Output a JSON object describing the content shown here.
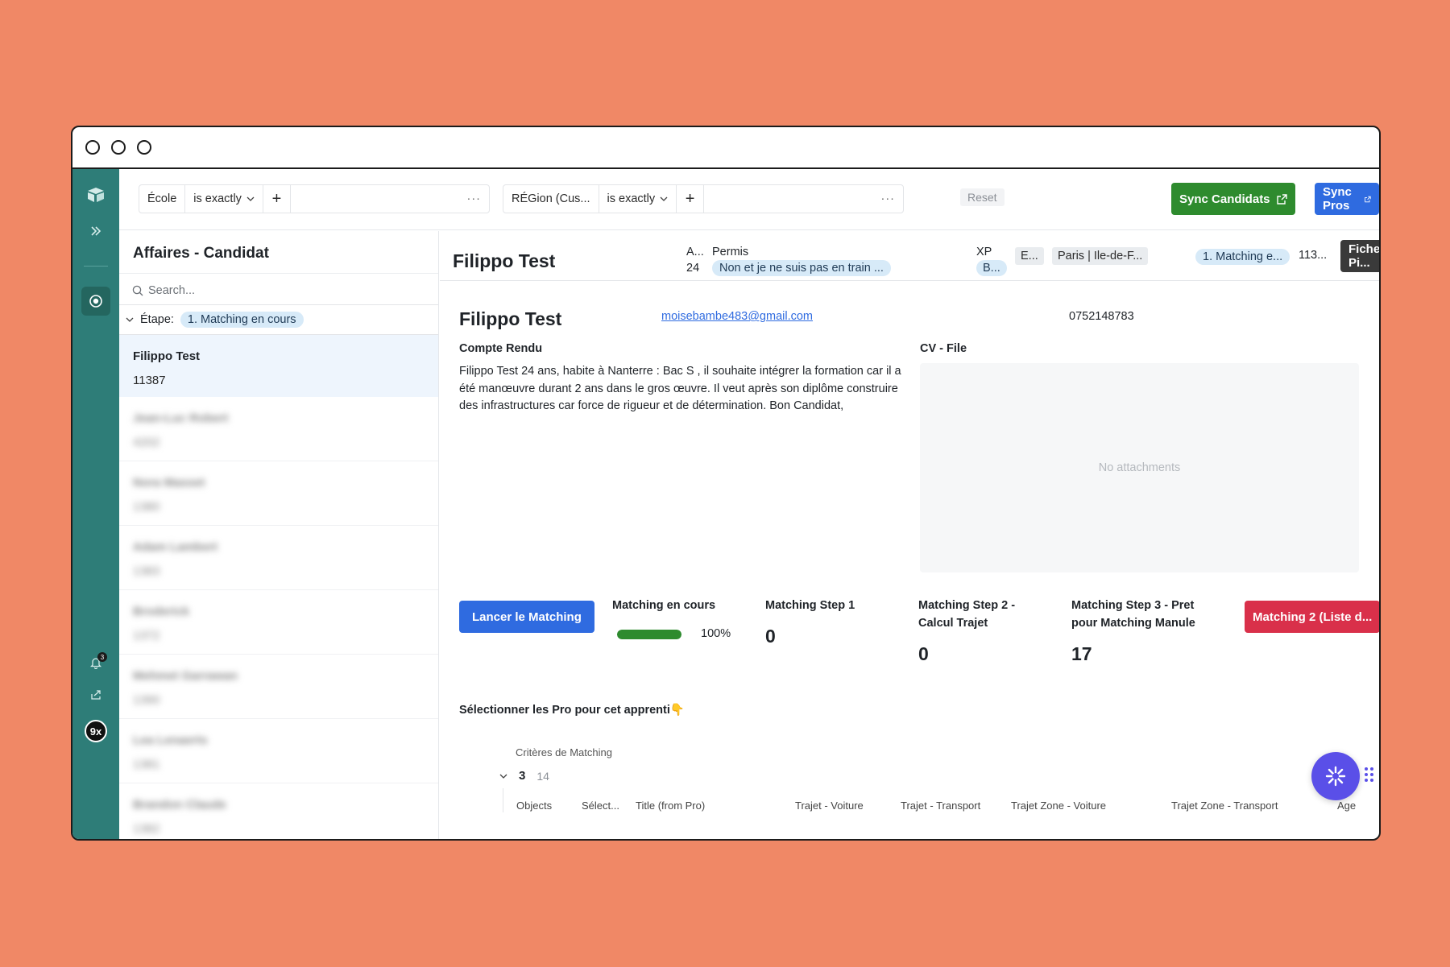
{
  "filters": {
    "f1": {
      "field": "École",
      "op": "is exactly",
      "more": "···"
    },
    "f2": {
      "field": "RÉGion (Cus...",
      "op": "is exactly",
      "more": "···"
    },
    "reset": "Reset"
  },
  "actions": {
    "sync_candidats": "Sync Candidats",
    "sync_pros": "Sync Pros"
  },
  "rail": {
    "notif_count": "3",
    "avatar": "9x"
  },
  "left": {
    "title": "Affaires - Candidat",
    "search_placeholder": "Search...",
    "group_label": "Étape:",
    "group_value": "1. Matching en cours",
    "rows": [
      {
        "title": "Filippo Test",
        "id": "11387"
      },
      {
        "title": "Jean-Luc Robert",
        "id": "4202"
      },
      {
        "title": "Nora Masset",
        "id": "1380"
      },
      {
        "title": "Adam Lambert",
        "id": "1383"
      },
      {
        "title": "Broderick",
        "id": "1372"
      },
      {
        "title": "Mehmet Garrawan",
        "id": "1390"
      },
      {
        "title": "Lea Lenaerts",
        "id": "1381"
      },
      {
        "title": "Brandon Claude",
        "id": "1382"
      }
    ]
  },
  "record": {
    "title": "Filippo Test",
    "age_label": "A...",
    "age_value": "24",
    "permis_label": "Permis",
    "permis_value": "Non et je ne suis pas en train ...",
    "xp_label": "XP",
    "xp_value": "B...",
    "pill_e": "E...",
    "region": "Paris | Ile-de-F...",
    "stage": "1. Matching e...",
    "id_trunc": "113...",
    "fiche": "Fiche Pi..."
  },
  "detail": {
    "name": "Filippo Test",
    "email": "moisebambe483@gmail.com",
    "phone": "0752148783",
    "cr_label": "Compte Rendu",
    "cr_text": "Filippo Test 24 ans, habite à Nanterre : Bac S , il souhaite intégrer la formation car il a été manœuvre durant 2 ans dans le gros œuvre. Il veut après son  diplôme construire des infrastructures car force de rigueur et de détermination. Bon Candidat,",
    "cv_label": "CV - File",
    "cv_empty": "No attachments"
  },
  "matching": {
    "launch": "Lancer le Matching",
    "en_cours_label": "Matching en cours",
    "progress_pct": 100,
    "progress_text": "100%",
    "step1_label": "Matching Step 1",
    "step1_value": "0",
    "step2_label_1": "Matching Step 2 -",
    "step2_label_2": "Calcul Trajet",
    "step2_value": "0",
    "step3_label_1": "Matching Step 3 - Pret",
    "step3_label_2": "pour Matching Manule",
    "step3_value": "17",
    "list_button": "Matching 2 (Liste d..."
  },
  "pros": {
    "title": "Sélectionner les Pro pour cet apprenti👇",
    "criteria": "Critères de Matching",
    "group_value": "3",
    "group_count": "14",
    "columns": [
      "Objects",
      "Sélect...",
      "Title (from Pro)",
      "Trajet - Voiture",
      "Trajet - Transport",
      "Trajet Zone - Voiture",
      "Trajet Zone - Transport",
      "Age"
    ]
  },
  "colors": {
    "accent_green": "#2E8B2E",
    "accent_blue": "#2F6BE0",
    "accent_red": "#D9304A",
    "rail": "#2E7D78",
    "background": "#F08866"
  }
}
